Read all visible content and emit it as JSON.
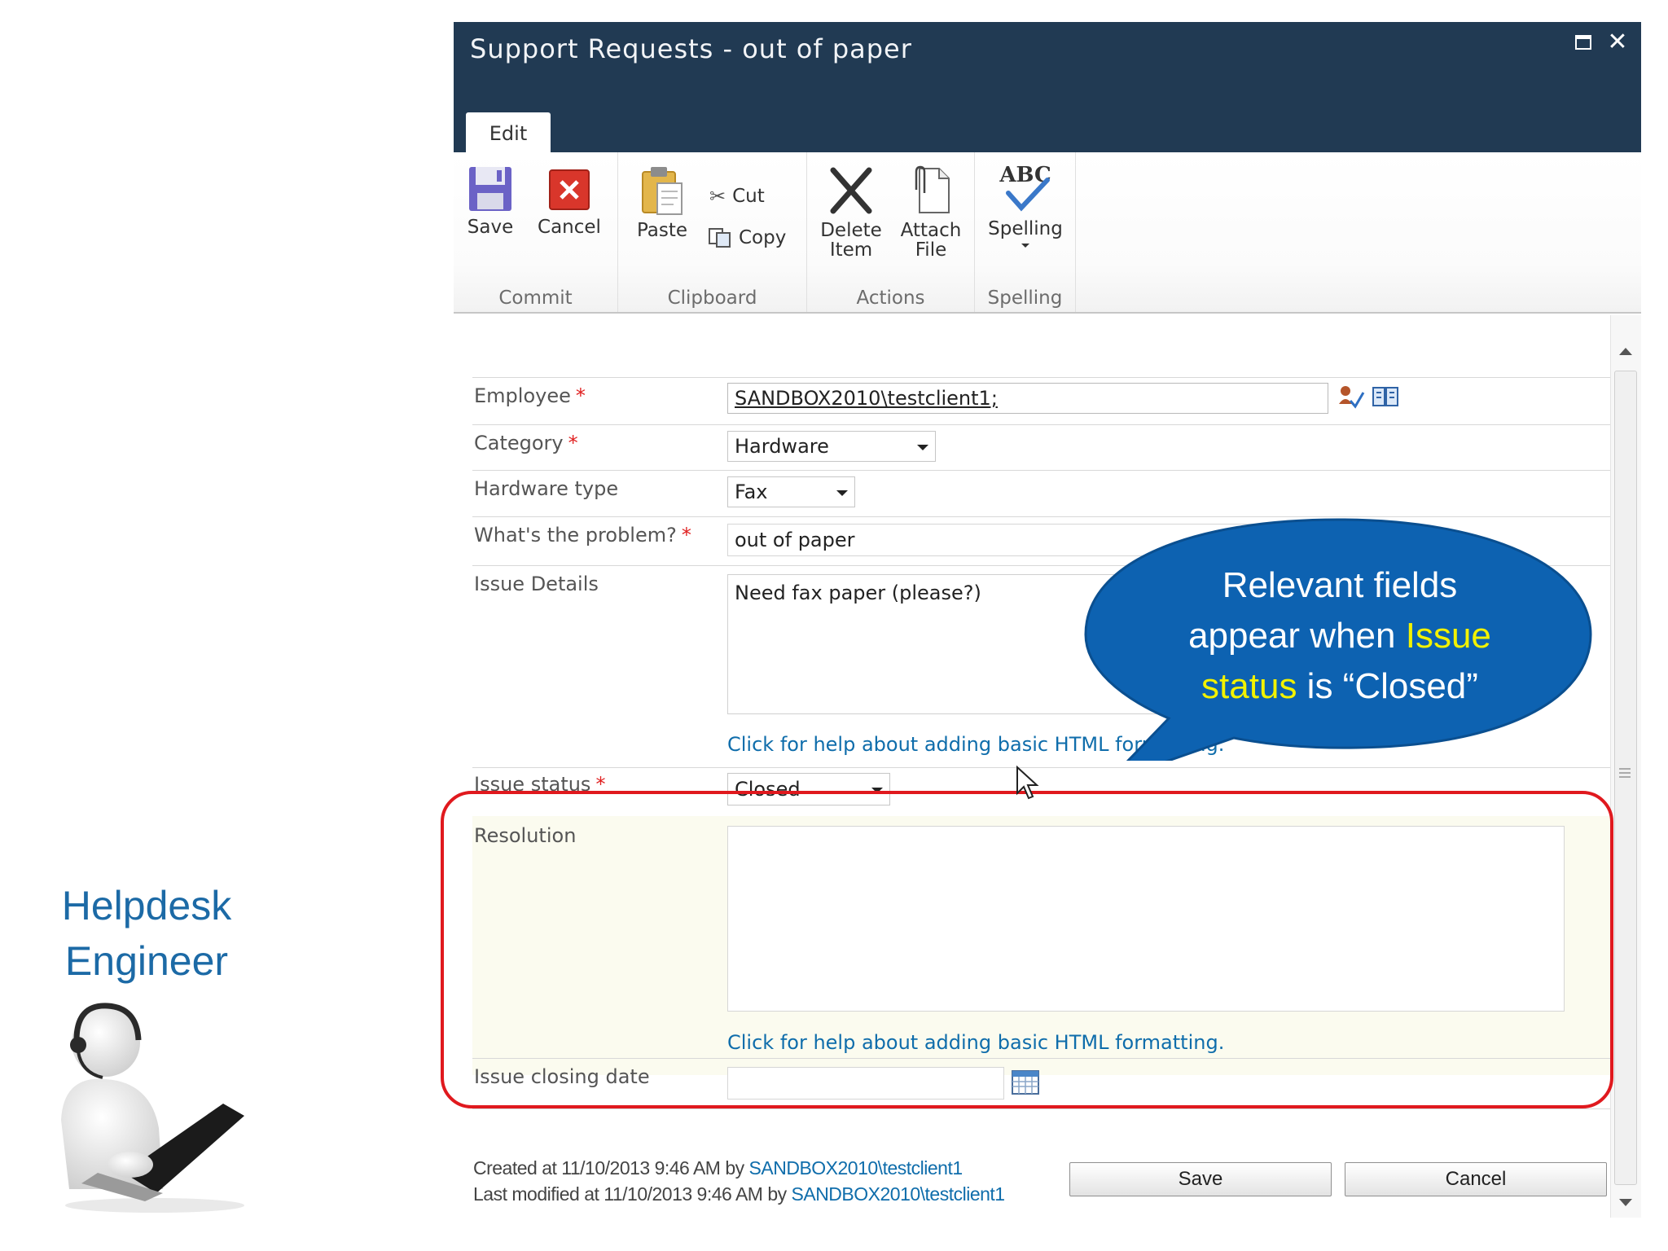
{
  "persona": {
    "title_line1": "Helpdesk",
    "title_line2": "Engineer"
  },
  "dialog": {
    "title": "Support Requests - out of paper",
    "tab": "Edit"
  },
  "ribbon": {
    "commit": {
      "group": "Commit",
      "save": "Save",
      "cancel": "Cancel"
    },
    "clipboard": {
      "group": "Clipboard",
      "paste": "Paste",
      "cut": "Cut",
      "copy": "Copy"
    },
    "actions": {
      "group": "Actions",
      "delete_line1": "Delete",
      "delete_line2": "Item",
      "attach_line1": "Attach",
      "attach_line2": "File"
    },
    "spelling": {
      "group": "Spelling",
      "spelling": "Spelling",
      "icon_text": "ABC"
    }
  },
  "form": {
    "employee": {
      "label": "Employee",
      "value": "SANDBOX2010\\testclient1;"
    },
    "category": {
      "label": "Category",
      "value": "Hardware"
    },
    "hardware_type": {
      "label": "Hardware type",
      "value": "Fax"
    },
    "problem": {
      "label": "What's the problem?",
      "value": "out of paper"
    },
    "issue_details": {
      "label": "Issue Details",
      "value": "Need fax paper (please?)",
      "help": "Click for help about adding basic HTML formatting."
    },
    "issue_status": {
      "label": "Issue status",
      "value": "Closed"
    },
    "resolution": {
      "label": "Resolution",
      "value": "",
      "help": "Click for help about adding basic HTML formatting."
    },
    "closing_date": {
      "label": "Issue closing date",
      "value": ""
    },
    "required_marker": "*"
  },
  "footer": {
    "created_prefix": "Created at 11/10/2013 9:46 AM by",
    "created_user": "SANDBOX2010\\testclient1",
    "modified_prefix": "Last modified at 11/10/2013 9:46 AM by",
    "modified_user": "SANDBOX2010\\testclient1",
    "save": "Save",
    "cancel": "Cancel"
  },
  "callout": {
    "line1": "Relevant fields",
    "line2_a": "appear when ",
    "line2_b": "Issue",
    "line3_a": "status",
    "line3_b": " is “Closed”"
  },
  "colors": {
    "titlebar": "#213a53",
    "callout": "#0d62b1",
    "callout_highlight": "#f2f200",
    "frame": "#e0191e",
    "link": "#0f6dab",
    "persona_text": "#1c6aa6"
  }
}
